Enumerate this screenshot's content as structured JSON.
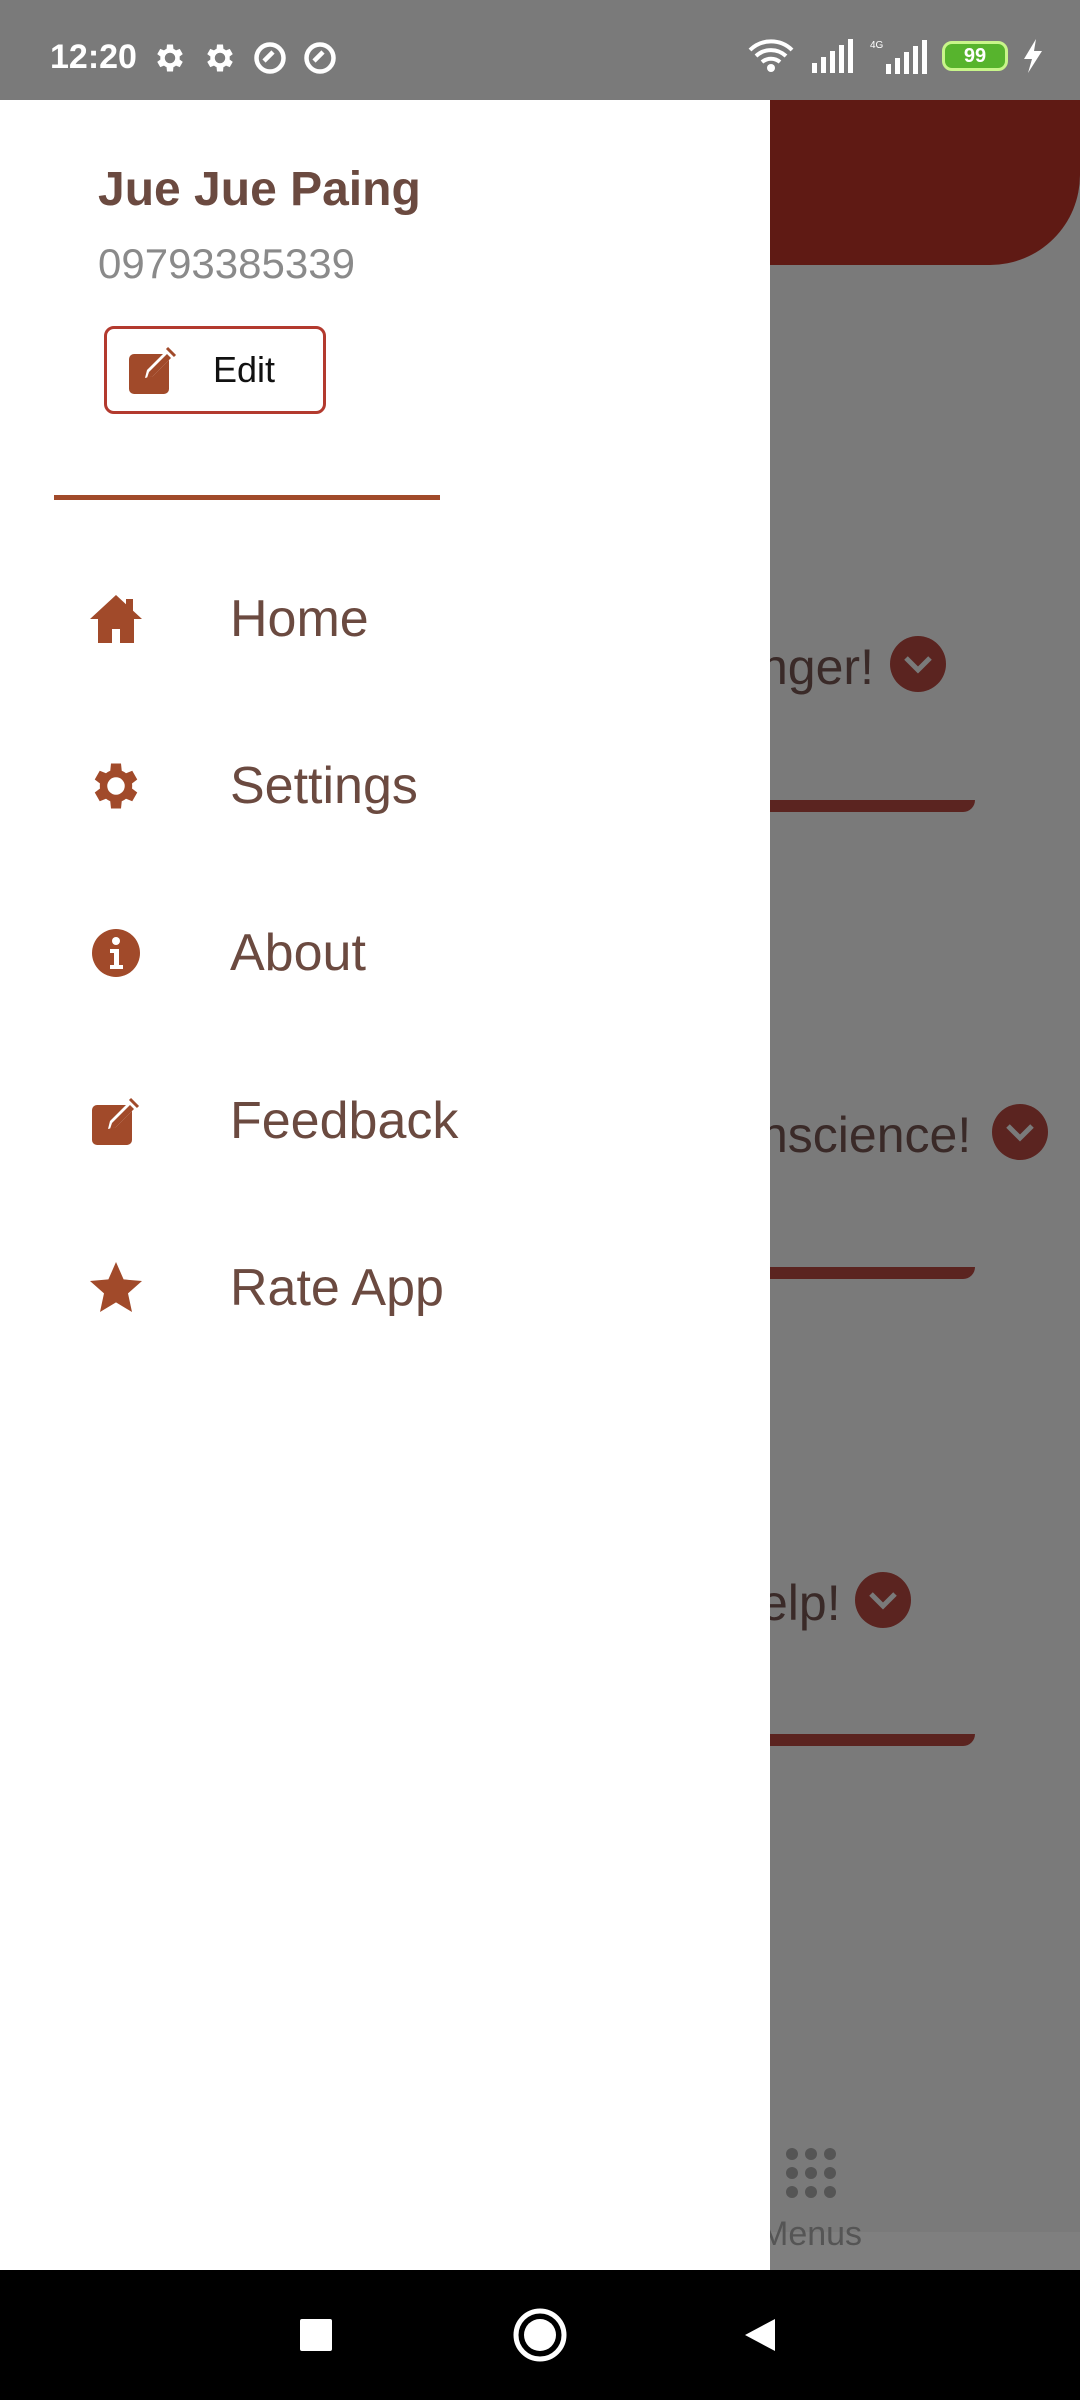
{
  "status_bar": {
    "time": "12:20",
    "battery": "99"
  },
  "drawer": {
    "user_name": "Jue Jue Paing",
    "phone": "09793385339",
    "edit_label": "Edit",
    "menu": [
      {
        "label": "Home",
        "icon": "home-icon"
      },
      {
        "label": "Settings",
        "icon": "gear-icon"
      },
      {
        "label": "About",
        "icon": "info-icon"
      },
      {
        "label": "Feedback",
        "icon": "edit-icon"
      },
      {
        "label": "Rate App",
        "icon": "star-icon"
      }
    ]
  },
  "background": {
    "items": [
      "nger!",
      "nscience!",
      "elp!"
    ],
    "menus_label": "Menus"
  },
  "colors": {
    "accent": "#a14a2a",
    "text_brown": "#6b4a40",
    "header_dark": "#5f1a14",
    "edit_border": "#b33a2e"
  }
}
